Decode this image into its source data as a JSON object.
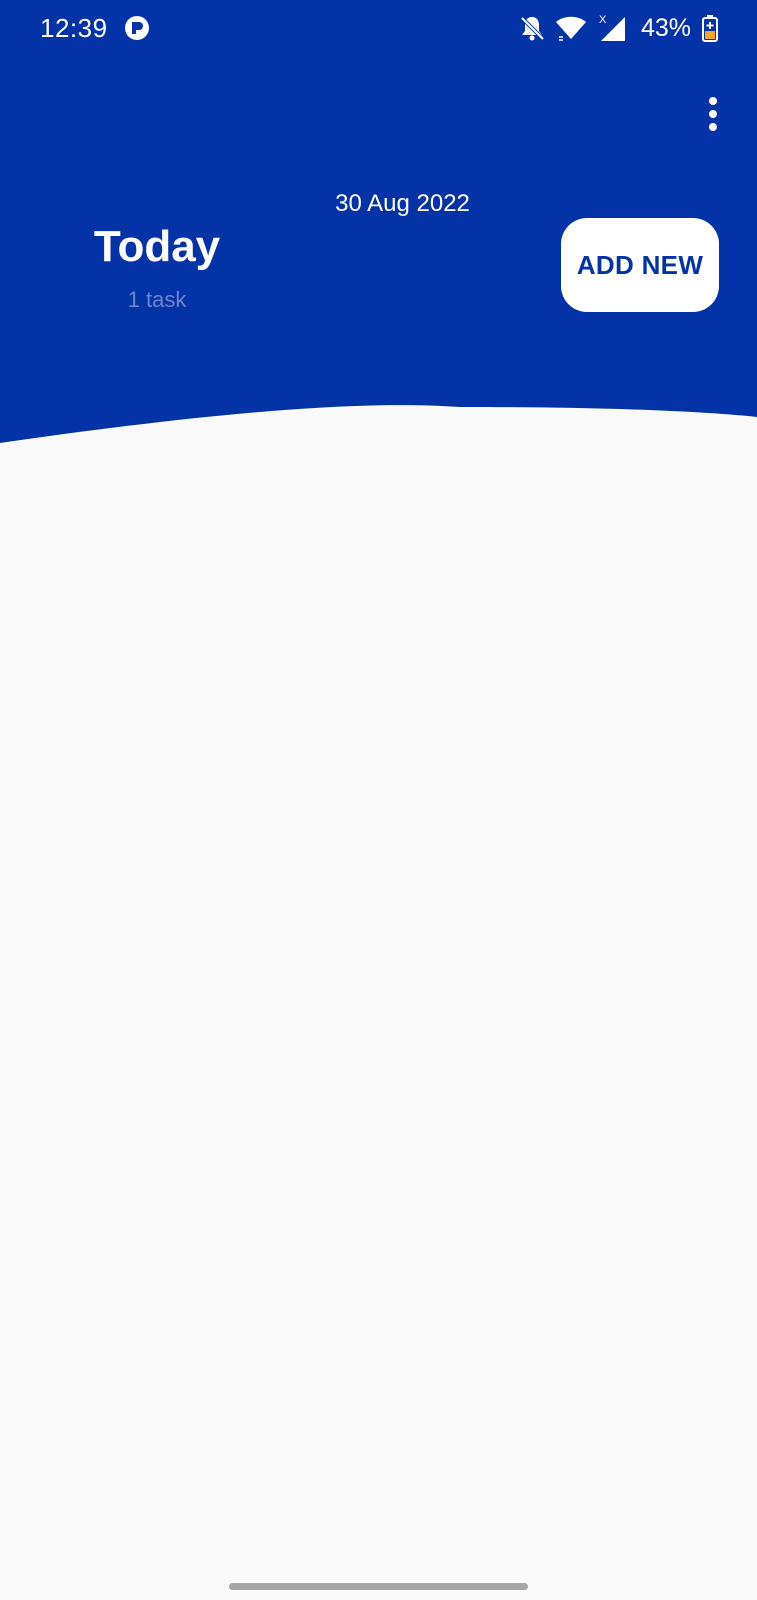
{
  "status_bar": {
    "time": "12:39",
    "battery": "43%",
    "signal_badge": "X",
    "icons": [
      "app-indicator-icon",
      "bell-off-icon",
      "wifi-icon",
      "cell-signal-icon",
      "battery-charging-icon"
    ]
  },
  "toolbar": {
    "overflow_icon": "more-vertical-icon"
  },
  "summary": {
    "date": "30 Aug 2022",
    "title": "Today",
    "task_count": "1 task",
    "add_button_label": "ADD NEW"
  },
  "colors": {
    "primary": "#0432a7",
    "background": "#fafafa",
    "muted_text": "#6f86c8",
    "battery_accent": "#f5a623"
  }
}
